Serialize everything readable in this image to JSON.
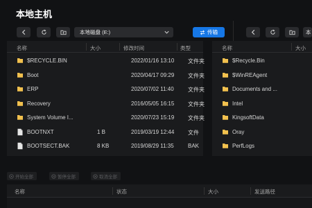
{
  "title": "本地主机",
  "toolbar": {
    "path": "本地磁盘 (E:)",
    "transfer_label": "传输"
  },
  "left_panel": {
    "columns": [
      "名称",
      "大小",
      "修改时间",
      "类型"
    ],
    "rows": [
      {
        "icon": "folder-icon",
        "name": "$RECYCLE.BIN",
        "size": "",
        "modified": "2022/01/16 13:10",
        "type": "文件夹"
      },
      {
        "icon": "folder-icon",
        "name": "Boot",
        "size": "",
        "modified": "2020/04/17 09:29",
        "type": "文件夹"
      },
      {
        "icon": "folder-icon",
        "name": "ERP",
        "size": "",
        "modified": "2020/07/02 11:40",
        "type": "文件夹"
      },
      {
        "icon": "folder-icon",
        "name": "Recovery",
        "size": "",
        "modified": "2016/05/05 16:15",
        "type": "文件夹"
      },
      {
        "icon": "folder-icon",
        "name": "System Volume I...",
        "size": "",
        "modified": "2020/07/23 15:19",
        "type": "文件夹"
      },
      {
        "icon": "file-icon",
        "name": "BOOTNXT",
        "size": "1 B",
        "modified": "2019/03/19 12:44",
        "type": "文件"
      },
      {
        "icon": "file-icon",
        "name": "BOOTSECT.BAK",
        "size": "8 KB",
        "modified": "2019/08/29 11:35",
        "type": "BAK"
      }
    ]
  },
  "right_panel": {
    "columns": [
      "名称",
      "大小"
    ],
    "rows": [
      {
        "icon": "folder-icon",
        "name": "$Recycle.Bin"
      },
      {
        "icon": "folder-icon",
        "name": "$WinREAgent"
      },
      {
        "icon": "folder-icon",
        "name": "Documents and ..."
      },
      {
        "icon": "folder-icon",
        "name": "Intel"
      },
      {
        "icon": "folder-icon",
        "name": "KingsoftData"
      },
      {
        "icon": "folder-icon",
        "name": "Oray"
      },
      {
        "icon": "folder-icon",
        "name": "PerfLogs"
      }
    ],
    "partial_path_char": "本"
  },
  "transfer_controls": {
    "start_all": "开始全部",
    "pause_all": "暂停全部",
    "cancel_all": "取消全部"
  },
  "transfer_list": {
    "columns": [
      "名称",
      "状态",
      "大小",
      "发送路径"
    ]
  },
  "colors": {
    "accent": "#1677e6",
    "folder": "#f2c14e",
    "background": "#111214",
    "panel": "#1a1b1d"
  }
}
